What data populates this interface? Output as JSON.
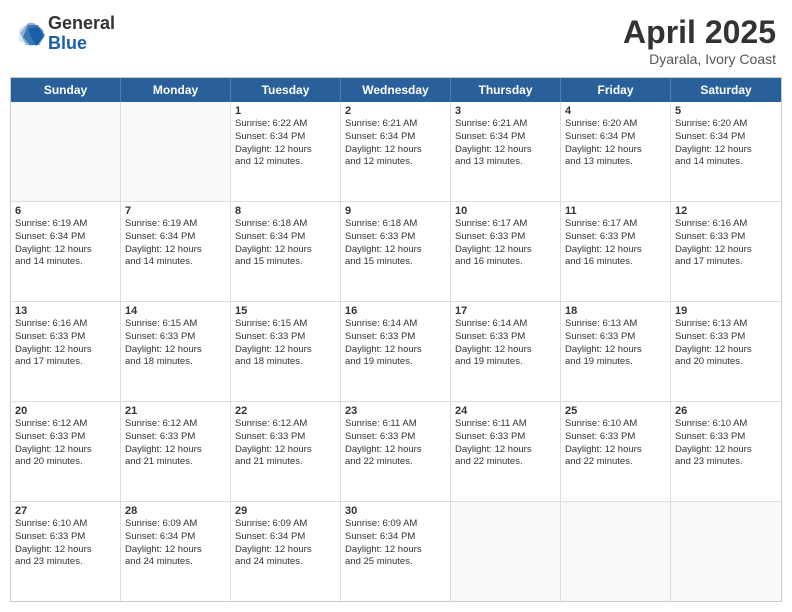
{
  "logo": {
    "general": "General",
    "blue": "Blue"
  },
  "header": {
    "title": "April 2025",
    "subtitle": "Dyarala, Ivory Coast"
  },
  "weekdays": [
    "Sunday",
    "Monday",
    "Tuesday",
    "Wednesday",
    "Thursday",
    "Friday",
    "Saturday"
  ],
  "rows": [
    [
      {
        "day": "",
        "lines": []
      },
      {
        "day": "",
        "lines": []
      },
      {
        "day": "1",
        "lines": [
          "Sunrise: 6:22 AM",
          "Sunset: 6:34 PM",
          "Daylight: 12 hours",
          "and 12 minutes."
        ]
      },
      {
        "day": "2",
        "lines": [
          "Sunrise: 6:21 AM",
          "Sunset: 6:34 PM",
          "Daylight: 12 hours",
          "and 12 minutes."
        ]
      },
      {
        "day": "3",
        "lines": [
          "Sunrise: 6:21 AM",
          "Sunset: 6:34 PM",
          "Daylight: 12 hours",
          "and 13 minutes."
        ]
      },
      {
        "day": "4",
        "lines": [
          "Sunrise: 6:20 AM",
          "Sunset: 6:34 PM",
          "Daylight: 12 hours",
          "and 13 minutes."
        ]
      },
      {
        "day": "5",
        "lines": [
          "Sunrise: 6:20 AM",
          "Sunset: 6:34 PM",
          "Daylight: 12 hours",
          "and 14 minutes."
        ]
      }
    ],
    [
      {
        "day": "6",
        "lines": [
          "Sunrise: 6:19 AM",
          "Sunset: 6:34 PM",
          "Daylight: 12 hours",
          "and 14 minutes."
        ]
      },
      {
        "day": "7",
        "lines": [
          "Sunrise: 6:19 AM",
          "Sunset: 6:34 PM",
          "Daylight: 12 hours",
          "and 14 minutes."
        ]
      },
      {
        "day": "8",
        "lines": [
          "Sunrise: 6:18 AM",
          "Sunset: 6:34 PM",
          "Daylight: 12 hours",
          "and 15 minutes."
        ]
      },
      {
        "day": "9",
        "lines": [
          "Sunrise: 6:18 AM",
          "Sunset: 6:33 PM",
          "Daylight: 12 hours",
          "and 15 minutes."
        ]
      },
      {
        "day": "10",
        "lines": [
          "Sunrise: 6:17 AM",
          "Sunset: 6:33 PM",
          "Daylight: 12 hours",
          "and 16 minutes."
        ]
      },
      {
        "day": "11",
        "lines": [
          "Sunrise: 6:17 AM",
          "Sunset: 6:33 PM",
          "Daylight: 12 hours",
          "and 16 minutes."
        ]
      },
      {
        "day": "12",
        "lines": [
          "Sunrise: 6:16 AM",
          "Sunset: 6:33 PM",
          "Daylight: 12 hours",
          "and 17 minutes."
        ]
      }
    ],
    [
      {
        "day": "13",
        "lines": [
          "Sunrise: 6:16 AM",
          "Sunset: 6:33 PM",
          "Daylight: 12 hours",
          "and 17 minutes."
        ]
      },
      {
        "day": "14",
        "lines": [
          "Sunrise: 6:15 AM",
          "Sunset: 6:33 PM",
          "Daylight: 12 hours",
          "and 18 minutes."
        ]
      },
      {
        "day": "15",
        "lines": [
          "Sunrise: 6:15 AM",
          "Sunset: 6:33 PM",
          "Daylight: 12 hours",
          "and 18 minutes."
        ]
      },
      {
        "day": "16",
        "lines": [
          "Sunrise: 6:14 AM",
          "Sunset: 6:33 PM",
          "Daylight: 12 hours",
          "and 19 minutes."
        ]
      },
      {
        "day": "17",
        "lines": [
          "Sunrise: 6:14 AM",
          "Sunset: 6:33 PM",
          "Daylight: 12 hours",
          "and 19 minutes."
        ]
      },
      {
        "day": "18",
        "lines": [
          "Sunrise: 6:13 AM",
          "Sunset: 6:33 PM",
          "Daylight: 12 hours",
          "and 19 minutes."
        ]
      },
      {
        "day": "19",
        "lines": [
          "Sunrise: 6:13 AM",
          "Sunset: 6:33 PM",
          "Daylight: 12 hours",
          "and 20 minutes."
        ]
      }
    ],
    [
      {
        "day": "20",
        "lines": [
          "Sunrise: 6:12 AM",
          "Sunset: 6:33 PM",
          "Daylight: 12 hours",
          "and 20 minutes."
        ]
      },
      {
        "day": "21",
        "lines": [
          "Sunrise: 6:12 AM",
          "Sunset: 6:33 PM",
          "Daylight: 12 hours",
          "and 21 minutes."
        ]
      },
      {
        "day": "22",
        "lines": [
          "Sunrise: 6:12 AM",
          "Sunset: 6:33 PM",
          "Daylight: 12 hours",
          "and 21 minutes."
        ]
      },
      {
        "day": "23",
        "lines": [
          "Sunrise: 6:11 AM",
          "Sunset: 6:33 PM",
          "Daylight: 12 hours",
          "and 22 minutes."
        ]
      },
      {
        "day": "24",
        "lines": [
          "Sunrise: 6:11 AM",
          "Sunset: 6:33 PM",
          "Daylight: 12 hours",
          "and 22 minutes."
        ]
      },
      {
        "day": "25",
        "lines": [
          "Sunrise: 6:10 AM",
          "Sunset: 6:33 PM",
          "Daylight: 12 hours",
          "and 22 minutes."
        ]
      },
      {
        "day": "26",
        "lines": [
          "Sunrise: 6:10 AM",
          "Sunset: 6:33 PM",
          "Daylight: 12 hours",
          "and 23 minutes."
        ]
      }
    ],
    [
      {
        "day": "27",
        "lines": [
          "Sunrise: 6:10 AM",
          "Sunset: 6:33 PM",
          "Daylight: 12 hours",
          "and 23 minutes."
        ]
      },
      {
        "day": "28",
        "lines": [
          "Sunrise: 6:09 AM",
          "Sunset: 6:34 PM",
          "Daylight: 12 hours",
          "and 24 minutes."
        ]
      },
      {
        "day": "29",
        "lines": [
          "Sunrise: 6:09 AM",
          "Sunset: 6:34 PM",
          "Daylight: 12 hours",
          "and 24 minutes."
        ]
      },
      {
        "day": "30",
        "lines": [
          "Sunrise: 6:09 AM",
          "Sunset: 6:34 PM",
          "Daylight: 12 hours",
          "and 25 minutes."
        ]
      },
      {
        "day": "",
        "lines": []
      },
      {
        "day": "",
        "lines": []
      },
      {
        "day": "",
        "lines": []
      }
    ]
  ]
}
